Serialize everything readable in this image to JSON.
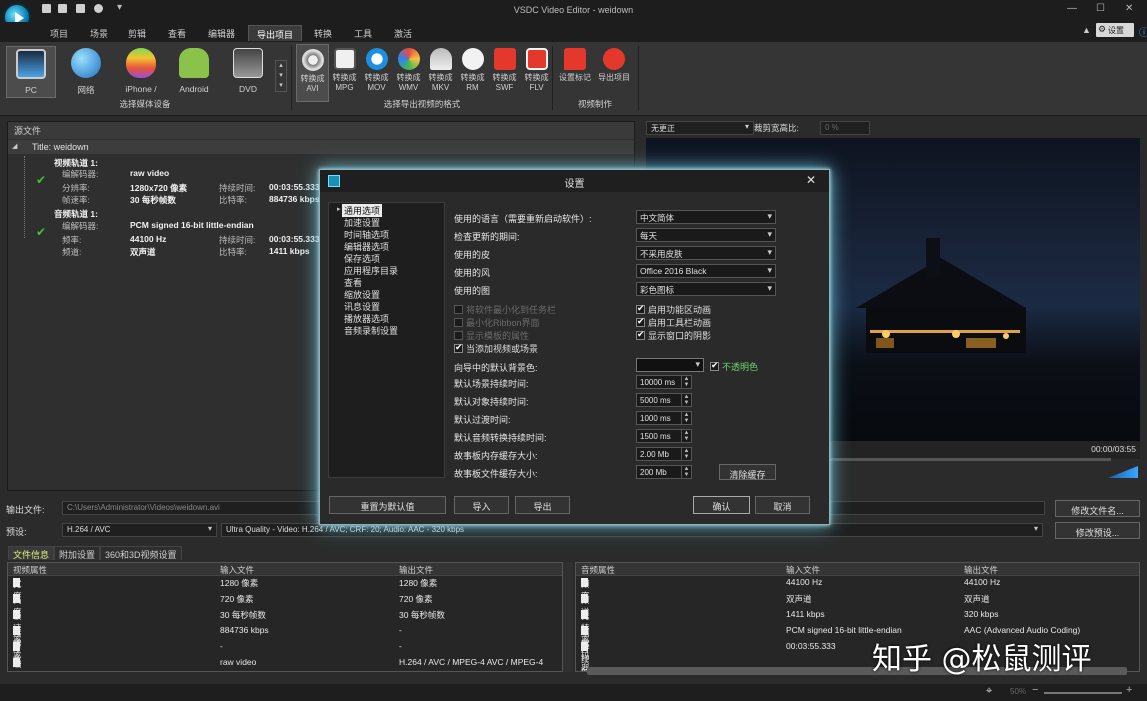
{
  "app": {
    "title": "VSDC Video Editor - weidown"
  },
  "menu": {
    "items": [
      "项目",
      "场景",
      "剪辑",
      "查看",
      "编辑器",
      "导出项目",
      "转换",
      "工具",
      "激活"
    ],
    "active_index": 5,
    "settings_label": "设置"
  },
  "ribbon": {
    "devices": [
      {
        "label": "PC",
        "icon": "pc-icon"
      },
      {
        "label": "网络",
        "icon": "globe-icon"
      },
      {
        "label": "iPhone /",
        "icon": "apple-icon"
      },
      {
        "label": "Android",
        "icon": "android-icon"
      },
      {
        "label": "DVD",
        "icon": "dvd-icon"
      }
    ],
    "devices_group": "选择媒体设备",
    "formats": [
      {
        "top": "转换成",
        "bottom": "AVI"
      },
      {
        "top": "转换成",
        "bottom": "MPG"
      },
      {
        "top": "转换成",
        "bottom": "MOV"
      },
      {
        "top": "转换成",
        "bottom": "WMV"
      },
      {
        "top": "转换成",
        "bottom": "MKV"
      },
      {
        "top": "转换成",
        "bottom": "RM"
      },
      {
        "top": "转换成",
        "bottom": "SWF"
      },
      {
        "top": "转换成",
        "bottom": "FLV"
      }
    ],
    "formats_group": "选择导出视频的格式",
    "video": [
      {
        "label": "设置标记"
      },
      {
        "label": "导出项目"
      }
    ],
    "video_group": "视频制作"
  },
  "source": {
    "header": "源文件",
    "title_row": "Title: weidown",
    "video_track": "视频轨道 1:",
    "video_rows": [
      {
        "k": "编解码器:",
        "v": "raw video"
      },
      {
        "k": "分辨率:",
        "v": "1280x720 像素",
        "k2": "持续时间:",
        "v2": "00:03:55.333"
      },
      {
        "k": "帧速率:",
        "v": "30 每秒帧数",
        "k2": "比特率:",
        "v2": "884736 kbps"
      }
    ],
    "audio_track": "音频轨道 1:",
    "audio_rows": [
      {
        "k": "编解码器:",
        "v": "PCM signed 16-bit little-endian"
      },
      {
        "k": "频率:",
        "v": "44100 Hz",
        "k2": "持续时间:",
        "v2": "00:03:55.333"
      },
      {
        "k": "频道:",
        "v": "双声道",
        "k2": "比特率:",
        "v2": "1411 kbps"
      }
    ]
  },
  "preview": {
    "mode": "无更正",
    "ratio_label": "裁剪宽高比:",
    "ratio_value": "0 %",
    "time": "00:00/03:55"
  },
  "dialog": {
    "title": "设置",
    "nav": [
      "通用选项",
      "加速设置",
      "时间轴选项",
      "编辑器选项",
      "保存选项",
      "应用程序目录",
      "查看",
      "缩放设置",
      "讯息设置",
      "播放器选项",
      "音频录制设置"
    ],
    "rows": [
      {
        "label": "使用的语言（需要重新启动软件）:",
        "value": "中文简体"
      },
      {
        "label": "检查更新的期间:",
        "value": "每天"
      },
      {
        "label": "使用的皮",
        "value": "不采用皮肤"
      },
      {
        "label": "使用的风",
        "value": "Office 2016 Black"
      },
      {
        "label": "使用的图",
        "value": "彩色图标"
      }
    ],
    "checks_left": [
      {
        "label": "将软件最小化到任务栏",
        "checked": false,
        "dim": true
      },
      {
        "label": "最小化Ribbon界面",
        "checked": false,
        "dim": true
      },
      {
        "label": "显示模板的属性",
        "checked": false,
        "dim": true
      },
      {
        "label": "当添加视频或场景",
        "checked": true,
        "dim": false
      }
    ],
    "checks_right": [
      {
        "label": "启用功能区动画",
        "checked": true
      },
      {
        "label": "启用工具栏动画",
        "checked": true
      },
      {
        "label": "显示窗口的阴影",
        "checked": true
      }
    ],
    "bg_label": "向导中的默认背景色:",
    "opaque_label": "不透明色",
    "spins": [
      {
        "label": "默认场景持续时间:",
        "value": "10000 ms"
      },
      {
        "label": "默认对象持续时间:",
        "value": "5000 ms"
      },
      {
        "label": "默认过渡时间:",
        "value": "1000 ms"
      },
      {
        "label": "默认音频转换持续时间:",
        "value": "1500 ms"
      },
      {
        "label": "故事板内存缓存大小:",
        "value": "2.00 Mb"
      },
      {
        "label": "故事板文件缓存大小:",
        "value": "200 Mb"
      }
    ],
    "clear_cache": "清除缓存",
    "reset": "重置为默认值",
    "import": "导入",
    "export": "导出",
    "ok": "确认",
    "cancel": "取消"
  },
  "output": {
    "file_label": "输出文件:",
    "file_value": "C:\\Users\\Administrator\\Videos\\weidown.avi",
    "rename": "修改文件名...",
    "preset_label": "预设:",
    "codec": "H.264 / AVC",
    "preset_value": "Ultra Quality - Video: H.264 / AVC; CRF: 20; Audio: AAC - 320 kbps",
    "edit_preset": "修改预设..."
  },
  "tabs": [
    "文件信息",
    "附加设置",
    "360和3D视频设置"
  ],
  "video_table": {
    "headers": [
      "视频属性",
      "输入文件",
      "输出文件"
    ],
    "rows": [
      [
        "宽度",
        "1280 像素",
        "1280 像素"
      ],
      [
        "高度",
        "720 像素",
        "720 像素"
      ],
      [
        "帧速率",
        "30 每秒帧数",
        "30 每秒帧数"
      ],
      [
        "比特率",
        "884736 kbps",
        "-"
      ],
      [
        "方位",
        "-",
        "-"
      ],
      [
        "编解码器",
        "raw video",
        "H.264 / AVC / MPEG-4 AVC / MPEG-4"
      ]
    ]
  },
  "audio_table": {
    "headers": [
      "音频属性",
      "输入文件",
      "输出文件"
    ],
    "rows": [
      [
        "频率",
        "44100 Hz",
        "44100 Hz"
      ],
      [
        "频道",
        "双声道",
        "双声道"
      ],
      [
        "比特率",
        "1411 kbps",
        "320 kbps"
      ],
      [
        "编解码器",
        "PCM signed 16-bit little-endian",
        "AAC (Advanced Audio Coding)"
      ],
      [
        "持续时间",
        "00:03:55.333",
        ""
      ]
    ]
  },
  "status": {
    "zoom": "50%"
  },
  "watermark": "知乎 @松鼠测评",
  "colors": {
    "accent": "#dff57f",
    "glow": "#6fc9dd"
  }
}
